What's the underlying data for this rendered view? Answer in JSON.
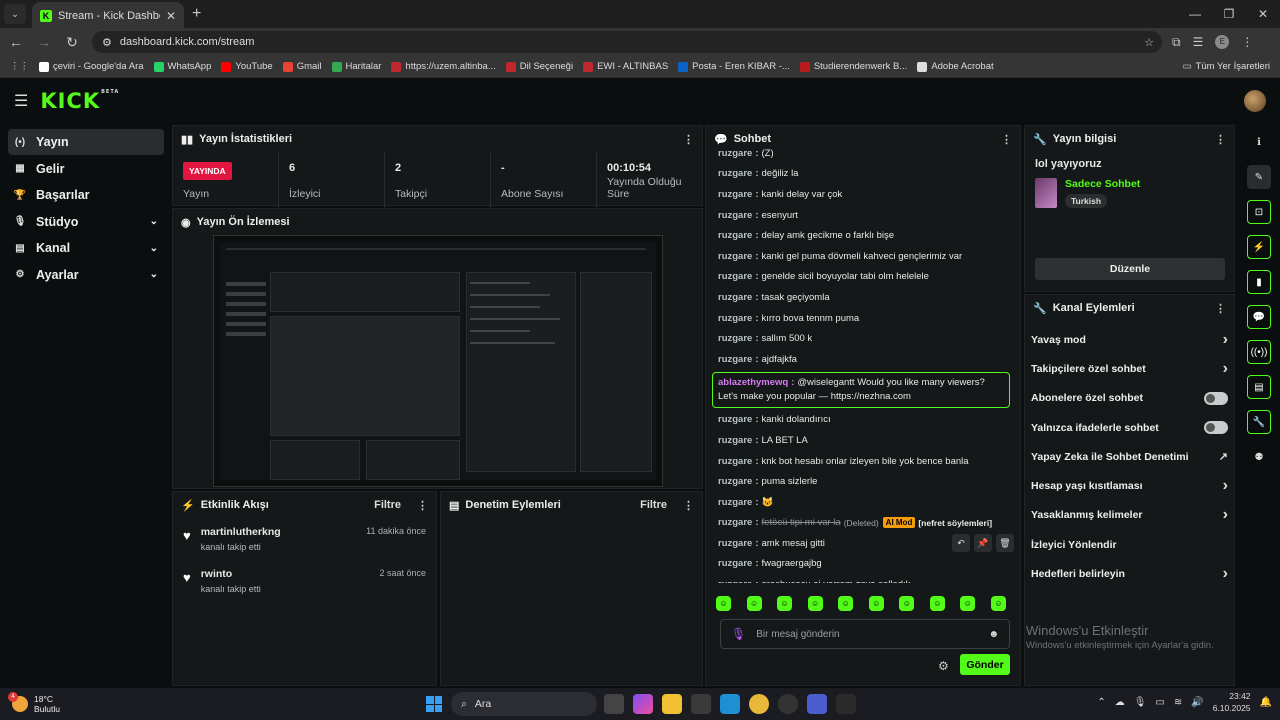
{
  "browser": {
    "tab_title": "Stream - Kick Dashboard",
    "url": "dashboard.kick.com/stream",
    "bookmarks": [
      {
        "label": "çeviri - Google'da Ara",
        "color": "#ffffff"
      },
      {
        "label": "WhatsApp",
        "color": "#25d366"
      },
      {
        "label": "YouTube",
        "color": "#ff0000"
      },
      {
        "label": "Gmail",
        "color": "#ea4335"
      },
      {
        "label": "Haritalar",
        "color": "#34a853"
      },
      {
        "label": "https://uzem.altinba...",
        "color": "#c0282e"
      },
      {
        "label": "Dil Seçeneği",
        "color": "#c0282e"
      },
      {
        "label": "EWI - ALTINBAS",
        "color": "#c0282e"
      },
      {
        "label": "Posta - Eren KIBAR -...",
        "color": "#0a64c8"
      },
      {
        "label": "Studierendenwerk B...",
        "color": "#b81c1c"
      },
      {
        "label": "Adobe Acrobat",
        "color": "#dddddd"
      }
    ],
    "all_bookmarks": "Tüm Yer İşaretleri",
    "profile_initial": "E"
  },
  "app": {
    "logo": "KICK",
    "beta": "BETA",
    "sidebar": [
      {
        "label": "Yayın",
        "active": true,
        "chevron": false
      },
      {
        "label": "Gelir",
        "chevron": false
      },
      {
        "label": "Başarılar",
        "chevron": false
      },
      {
        "label": "Stüdyo",
        "chevron": true
      },
      {
        "label": "Kanal",
        "chevron": true
      },
      {
        "label": "Ayarlar",
        "chevron": true
      }
    ],
    "stats": {
      "title": "Yayın İstatistikleri",
      "live_badge": "YAYINDA",
      "live_label": "Yayın",
      "viewers_value": "6",
      "viewers_label": "İzleyici",
      "followers_value": "2",
      "followers_label": "Takipçi",
      "subs_value": "-",
      "subs_label": "Abone Sayısı",
      "duration_value": "00:10:54",
      "duration_label": "Yayında Olduğu Süre"
    },
    "preview_title": "Yayın Ön İzlemesi",
    "activity": {
      "title": "Etkinlik Akışı",
      "filter": "Filtre",
      "events": [
        {
          "user": "martinlutherkng",
          "action": "kanalı takip etti",
          "time": "11 dakika önce"
        },
        {
          "user": "rwinto",
          "action": "kanalı takip etti",
          "time": "2 saat önce"
        }
      ]
    },
    "moderation": {
      "title": "Denetim Eylemleri",
      "filter": "Filtre"
    },
    "chat": {
      "title": "Sohbet",
      "messages": [
        {
          "user": "ruzgare",
          "text": "(Z)"
        },
        {
          "user": "ruzgare",
          "text": "değiliz la"
        },
        {
          "user": "ruzgare",
          "text": "kanki delay var çok"
        },
        {
          "user": "ruzgare",
          "text": "esenyurt"
        },
        {
          "user": "ruzgare",
          "text": "delay amk gecikme o farklı bişe"
        },
        {
          "user": "ruzgare",
          "text": "kanki gel puma dövmeli kahveci gençlerimiz var"
        },
        {
          "user": "ruzgare",
          "text": "genelde sicil boyuyolar tabi olm helelele"
        },
        {
          "user": "ruzgare",
          "text": "tasak geçiyomla"
        },
        {
          "user": "ruzgare",
          "text": "kırro bova tennm puma"
        },
        {
          "user": "ruzgare",
          "text": "sallım 500 k"
        },
        {
          "user": "ruzgare",
          "text": "ajdfajkfa"
        }
      ],
      "highlight": {
        "user": "ablazethymewq",
        "text": "@wiselegantt Would you like many viewers? Let's make you popular — https://nezhna.com"
      },
      "messages2": [
        {
          "user": "ruzgare",
          "text": "kanki dolandırıcı"
        },
        {
          "user": "ruzgare",
          "text": "LA BET LA"
        },
        {
          "user": "ruzgare",
          "text": "knk bot hesabı onlar izleyen bile yok bence banla"
        },
        {
          "user": "ruzgare",
          "text": "puma sizlerle"
        },
        {
          "user": "ruzgare",
          "text": "😺"
        }
      ],
      "deleted": {
        "user": "ruzgare",
        "text": "fetöcü tipi mi var la",
        "deleted_tag": "(Deleted)",
        "aimod": "AI Mod",
        "reason": "[nefret söylemleri]"
      },
      "messages3": [
        {
          "user": "ruzgare",
          "text": "amk mesaj gitti"
        },
        {
          "user": "ruzgare",
          "text": "fwagraergajbg"
        },
        {
          "user": "ruzgare",
          "text": "orosbucocu ai yarram gsye salladık"
        }
      ],
      "input_placeholder": "Bir mesaj gönderin",
      "send": "Gönder"
    },
    "stream_info": {
      "title": "Yayın bilgisi",
      "stream_title": "lol yayıyoruz",
      "category": "Sadece Sohbet",
      "language": "Turkish",
      "edit": "Düzenle"
    },
    "channel_actions": {
      "title": "Kanal Eylemleri",
      "items": [
        {
          "label": "Yavaş mod",
          "kind": "arrow"
        },
        {
          "label": "Takipçilere özel sohbet",
          "kind": "arrow"
        },
        {
          "label": "Abonelere özel sohbet",
          "kind": "toggle"
        },
        {
          "label": "Yalnızca ifadelerle sohbet",
          "kind": "toggle"
        },
        {
          "label": "Yapay Zeka ile Sohbet Denetimi",
          "kind": "external"
        },
        {
          "label": "Hesap yaşı kısıtlaması",
          "kind": "arrow"
        },
        {
          "label": "Yasaklanmış kelimeler",
          "kind": "arrow"
        },
        {
          "label": "İzleyici Yönlendir",
          "kind": "none"
        },
        {
          "label": "Hedefleri belirleyin",
          "kind": "arrow"
        }
      ]
    },
    "watermark": {
      "line1": "Windows'u Etkinleştir",
      "line2": "Windows'u etkinleştirmek için Ayarlar'a gidin."
    }
  },
  "taskbar": {
    "temp": "18°C",
    "weather": "Bulutlu",
    "notif_count": "4",
    "search": "Ara",
    "time": "23:42",
    "date": "6.10.2025"
  },
  "colors": {
    "accent": "#53fc18",
    "live": "#e3163f",
    "highlight_user": "#d77bf6"
  }
}
